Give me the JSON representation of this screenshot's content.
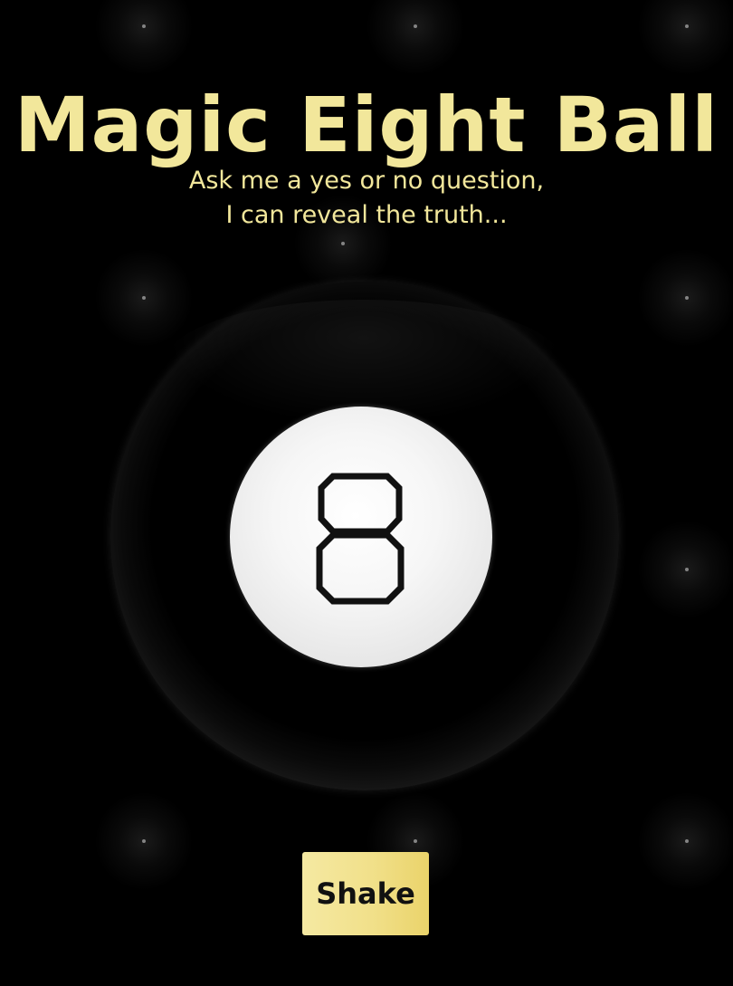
{
  "header": {
    "title": "Magic Eight Ball"
  },
  "intro": {
    "line1": "Ask me a yes or no question,",
    "line2": "I can reveal the truth..."
  },
  "ball": {
    "window_text": "8",
    "icon": "magic-8-ball-icon"
  },
  "actions": {
    "shake_label": "Shake"
  },
  "colors": {
    "accent": "#f2e79b",
    "background": "#000000",
    "button": "#f1e08a",
    "button_text": "#111111"
  }
}
